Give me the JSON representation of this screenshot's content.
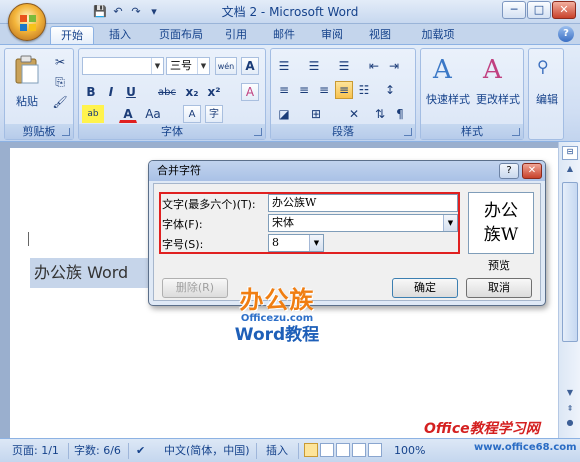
{
  "window": {
    "title": "文档 2 - Microsoft Word",
    "controls": {
      "minimize": "─",
      "maximize": "□",
      "close": "✕"
    }
  },
  "qat": {
    "save": "💾",
    "undo": "↶",
    "redo": "↷",
    "more": "▾"
  },
  "tabs": [
    "开始",
    "插入",
    "页面布局",
    "引用",
    "邮件",
    "审阅",
    "视图",
    "加载项"
  ],
  "active_tab": "开始",
  "ribbon": {
    "clipboard": {
      "label": "剪贴板",
      "paste": "粘贴"
    },
    "font": {
      "label": "字体",
      "font_name": "",
      "font_size": "三号",
      "wen": "wén",
      "A_box": "A",
      "bold": "B",
      "italic": "I",
      "underline": "U",
      "strike": "abc",
      "sub": "x₂",
      "sup": "x²",
      "aa": "Aa",
      "clear": "A"
    },
    "paragraph": {
      "label": "段落"
    },
    "styles": {
      "label": "样式",
      "quick_styles": "快速样式",
      "change_styles": "更改样式"
    },
    "editing": {
      "label": "编辑"
    }
  },
  "document": {
    "selected_text": "办公族   Word"
  },
  "dialog": {
    "title": "合并字符",
    "help": "?",
    "close": "✕",
    "text_label": "文字(最多六个)(T):",
    "text_value": "办公族W",
    "font_label": "字体(F):",
    "font_value": "宋体",
    "size_label": "字号(S):",
    "size_value": "8",
    "preview_line1": "办公",
    "preview_line2": "族W",
    "preview_label": "预览",
    "delete_btn": "删除(R)",
    "ok_btn": "确定",
    "cancel_btn": "取消"
  },
  "watermark": {
    "logo": "办公族",
    "site": "Officezu.com",
    "course": "Word教程",
    "corner": "Office教程学习网",
    "corner_url": "www.office68.com"
  },
  "status": {
    "page": "页面: 1/1",
    "words": "字数: 6/6",
    "lang": "中文(简体，中国)",
    "mode": "插入",
    "zoom": "100%"
  },
  "colors": {
    "accent": "#15428b",
    "ribbon_bg": "#d0def3",
    "dialog_frame": "#e02020"
  }
}
